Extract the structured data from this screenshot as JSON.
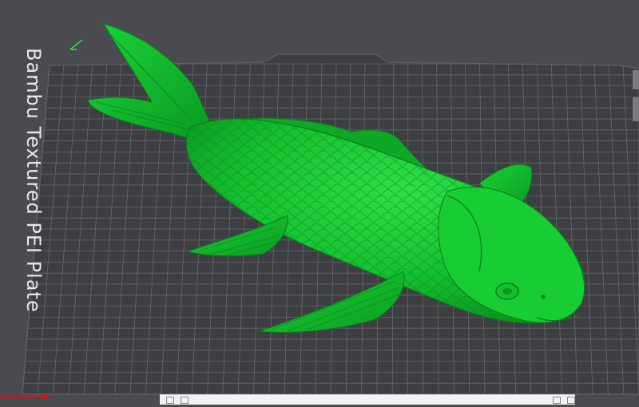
{
  "viewport": {
    "background": "#4a4b50",
    "plate": {
      "name": "Bambu Textured PEI Plate",
      "surface_color": "#3d3e42",
      "grid_color": "#6e6f74",
      "label_color": "#e9e9ea"
    },
    "model": {
      "description_icon": "koi-fish-model",
      "color": "#14c22e"
    }
  },
  "toolbar": {
    "filename": "",
    "icons": [
      "layer-icon",
      "grid-icon",
      "camera-icon",
      "settings-icon"
    ]
  }
}
